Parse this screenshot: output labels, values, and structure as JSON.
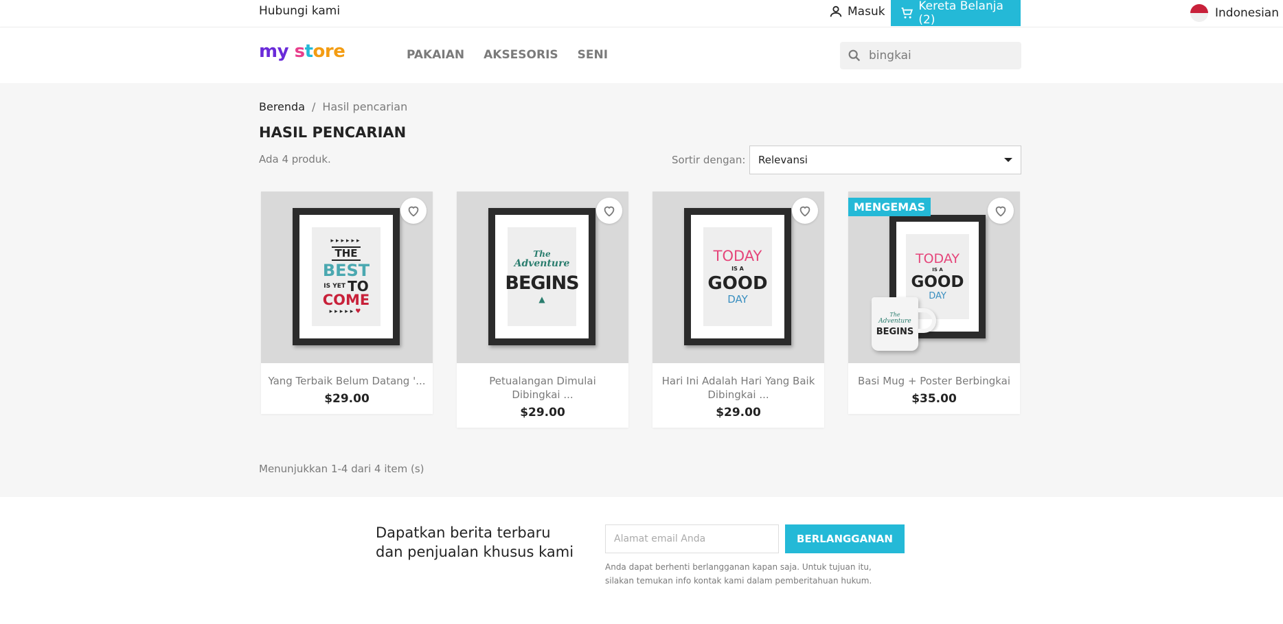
{
  "topnav": {
    "contact": "Hubungi kami",
    "signin": "Masuk",
    "cart": "Kereta Belanja (2)",
    "language": "Indonesian"
  },
  "header": {
    "logo_parts": [
      "my",
      " ",
      "s",
      "t",
      "ore"
    ],
    "menu": [
      "PAKAIAN",
      "AKSESORIS",
      "SENI"
    ],
    "search_value": "bingkai"
  },
  "breadcrumb": {
    "home": "Berenda",
    "separator": "/",
    "current": "Hasil pencarian"
  },
  "listing": {
    "title": "HASIL PENCARIAN",
    "count": "Ada 4 produk.",
    "sort_label": "Sortir dengan:",
    "sort_value": "Relevansi",
    "showing": "Menunjukkan 1-4 dari 4 item (s)"
  },
  "products": [
    {
      "name": "Yang Terbaik Belum Datang '...",
      "price": "$29.00",
      "poster": [
        "THE",
        "BEST",
        "IS YET",
        "TO",
        "COME"
      ]
    },
    {
      "name": "Petualangan Dimulai Dibingkai ...",
      "price": "$29.00",
      "poster": [
        "The",
        "Adventure",
        "BEGINS"
      ]
    },
    {
      "name": "Hari Ini Adalah Hari Yang Baik Dibingkai ...",
      "price": "$29.00",
      "poster": [
        "TODAY",
        "IS A",
        "GOOD",
        "DAY"
      ]
    },
    {
      "name": "Basi Mug + Poster Berbingkai",
      "price": "$35.00",
      "badge": "MENGEMAS",
      "poster": [
        "TODAY",
        "IS A",
        "GOOD",
        "DAY"
      ],
      "mug": [
        "The",
        "Adventure",
        "BEGINS"
      ]
    }
  ],
  "newsletter": {
    "title": "Dapatkan berita terbaru dan penjualan khusus kami",
    "placeholder": "Alamat email Anda",
    "button": "BERLANGGANAN",
    "note": "Anda dapat berhenti berlangganan kapan saja. Untuk tujuan itu, silakan temukan info kontak kami dalam pemberitahuan hukum."
  },
  "colors": {
    "accent": "#24b9d7",
    "text": "#232323",
    "muted": "#7a7a7a",
    "background": "#f6f6f6"
  }
}
